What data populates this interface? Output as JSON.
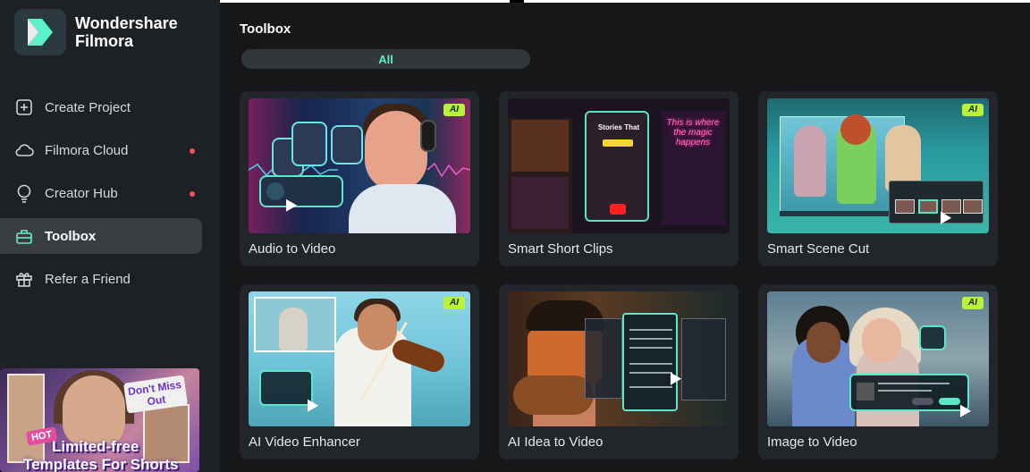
{
  "app": {
    "brand_line1": "Wondershare",
    "brand_line2": "Filmora"
  },
  "sidebar": {
    "items": [
      {
        "label": "Create Project",
        "icon": "plus-square-icon",
        "active": false,
        "dot": false
      },
      {
        "label": "Filmora Cloud",
        "icon": "cloud-icon",
        "active": false,
        "dot": true
      },
      {
        "label": "Creator Hub",
        "icon": "lightbulb-icon",
        "active": false,
        "dot": true
      },
      {
        "label": "Toolbox",
        "icon": "toolbox-icon",
        "active": true,
        "dot": false
      },
      {
        "label": "Refer a Friend",
        "icon": "gift-icon",
        "active": false,
        "dot": false
      }
    ],
    "promo": {
      "sticker": "Don't Miss Out",
      "hot": "HOT",
      "title_line1": "Limited-free",
      "title_line2": "Templates For Shorts"
    }
  },
  "main": {
    "title": "Toolbox",
    "filter_label": "All",
    "cards": [
      {
        "label": "Audio to Video",
        "ai": true
      },
      {
        "label": "Smart Short Clips",
        "ai": false
      },
      {
        "label": "Smart Scene Cut",
        "ai": true
      },
      {
        "label": "AI Video Enhancer",
        "ai": true
      },
      {
        "label": "AI Idea to Video",
        "ai": false
      },
      {
        "label": "Image to Video",
        "ai": true
      }
    ],
    "ai_badge": "AI",
    "thumb_texts": {
      "stories": "Stories That",
      "neon": "This is where the magic happens"
    }
  },
  "colors": {
    "accent": "#5ef0c8",
    "ai_badge": "#b9f23a",
    "notification_dot": "#f0505f",
    "sidebar_bg": "#1e2124",
    "main_bg": "#151719",
    "card_bg": "#22262a"
  }
}
